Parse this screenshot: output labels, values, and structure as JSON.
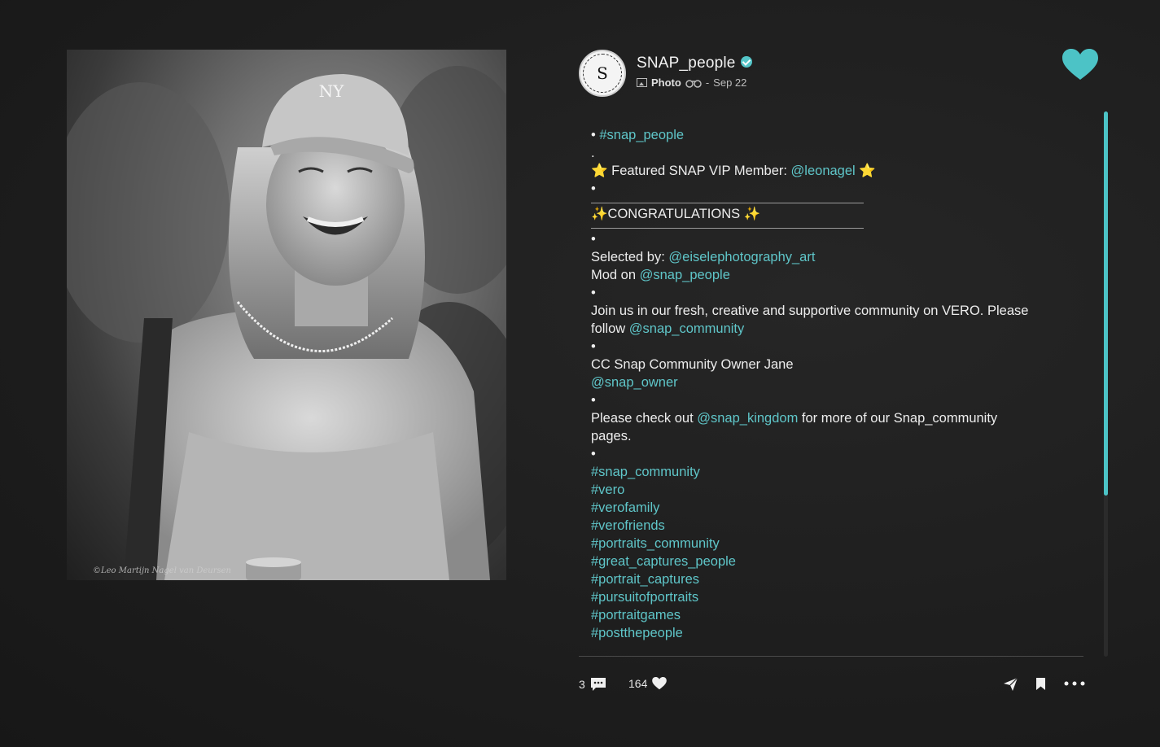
{
  "post": {
    "username": "SNAP_people",
    "post_type": "Photo",
    "date": "Sep 22",
    "separator": "-",
    "avatar_letter": "S",
    "watermark": "©Leo Martijn Nagel van Deursen"
  },
  "caption": [
    [
      {
        "t": "• "
      },
      {
        "t": "#snap_people",
        "link": true
      }
    ],
    [
      {
        "t": "."
      }
    ],
    [
      {
        "t": "⭐ Featured SNAP VIP Member: "
      },
      {
        "t": "@leonagel",
        "link": true
      },
      {
        "t": " ⭐"
      }
    ],
    [
      {
        "t": "•"
      }
    ],
    [
      {
        "rule": true
      }
    ],
    [
      {
        "t": "✨CONGRATULATIONS ✨"
      }
    ],
    [
      {
        "rule": true
      }
    ],
    [
      {
        "t": "•"
      }
    ],
    [
      {
        "t": "Selected by: "
      },
      {
        "t": "@eiselephotography_art",
        "link": true
      }
    ],
    [
      {
        "t": "Mod on "
      },
      {
        "t": "@snap_people",
        "link": true
      }
    ],
    [
      {
        "t": "•"
      }
    ],
    [
      {
        "t": "Join us in our fresh, creative and supportive community on VERO. Please"
      }
    ],
    [
      {
        "t": "follow "
      },
      {
        "t": "@snap_community",
        "link": true
      }
    ],
    [
      {
        "t": "•"
      }
    ],
    [
      {
        "t": "CC Snap Community Owner Jane"
      }
    ],
    [
      {
        "t": "@snap_owner",
        "link": true
      }
    ],
    [
      {
        "t": "•"
      }
    ],
    [
      {
        "t": "Please check out "
      },
      {
        "t": "@snap_kingdom",
        "link": true
      },
      {
        "t": " for more of our Snap_community"
      }
    ],
    [
      {
        "t": "pages."
      }
    ],
    [
      {
        "t": "•"
      }
    ],
    [
      {
        "t": "#snap_community",
        "link": true
      }
    ],
    [
      {
        "t": "#vero",
        "link": true
      }
    ],
    [
      {
        "t": "#verofamily",
        "link": true
      }
    ],
    [
      {
        "t": "#verofriends",
        "link": true
      }
    ],
    [
      {
        "t": "#portraits_community",
        "link": true
      }
    ],
    [
      {
        "t": "#great_captures_people",
        "link": true
      }
    ],
    [
      {
        "t": "#portrait_captures",
        "link": true
      }
    ],
    [
      {
        "t": "#pursuitofportraits",
        "link": true
      }
    ],
    [
      {
        "t": "#portraitgames",
        "link": true
      }
    ],
    [
      {
        "t": "#postthepeople",
        "link": true
      }
    ]
  ],
  "actions": {
    "comments_count": "3",
    "likes_count": "164"
  },
  "colors": {
    "accent": "#4cc3c6",
    "link": "#5fc6c9",
    "background": "#1e1e1e"
  },
  "icons": [
    "verified-icon",
    "photo-type-icon",
    "binoculars-icon",
    "heart-icon",
    "comment-icon",
    "like-icon",
    "share-icon",
    "bookmark-icon",
    "more-icon"
  ]
}
